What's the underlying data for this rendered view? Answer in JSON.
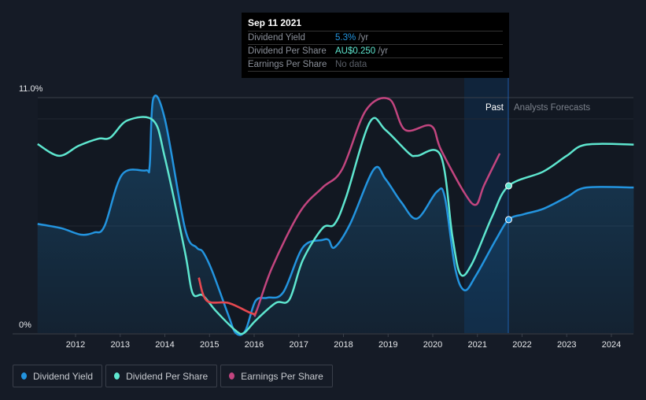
{
  "tooltip": {
    "date": "Sep 11 2021",
    "rows": [
      {
        "label": "Dividend Yield",
        "value": "5.3%",
        "unit": "/yr",
        "color": "#2394df"
      },
      {
        "label": "Dividend Per Share",
        "value": "AU$0.250",
        "unit": "/yr",
        "color": "#5ee6cf"
      },
      {
        "label": "Earnings Per Share",
        "value": "No data",
        "unit": "",
        "color": "#6b7079"
      }
    ]
  },
  "labels": {
    "past": "Past",
    "forecast": "Analysts Forecasts"
  },
  "legend": [
    {
      "label": "Dividend Yield",
      "color": "#2394df"
    },
    {
      "label": "Dividend Per Share",
      "color": "#5ee6cf"
    },
    {
      "label": "Earnings Per Share",
      "color": "#c2457f"
    }
  ],
  "chart_data": {
    "type": "line",
    "y_ticks": [
      "11.0%",
      "0%"
    ],
    "ylim": [
      0,
      11
    ],
    "x_ticks": [
      "2012",
      "2013",
      "2014",
      "2015",
      "2016",
      "2017",
      "2018",
      "2019",
      "2020",
      "2021",
      "2022",
      "2023",
      "2024"
    ],
    "forecast_start": 2021.7,
    "series": [
      {
        "name": "Dividend Yield",
        "unit": "%",
        "color": "#2394df",
        "points": [
          [
            2011.15,
            5.1
          ],
          [
            2011.68,
            4.9
          ],
          [
            2012.12,
            4.6
          ],
          [
            2012.42,
            4.7
          ],
          [
            2012.65,
            5.0
          ],
          [
            2013.04,
            7.4
          ],
          [
            2013.57,
            7.6
          ],
          [
            2013.66,
            7.8
          ],
          [
            2013.74,
            10.95
          ],
          [
            2014.0,
            10.0
          ],
          [
            2014.45,
            4.9
          ],
          [
            2014.71,
            4.0
          ],
          [
            2014.85,
            3.8
          ],
          [
            2015.06,
            2.9
          ],
          [
            2015.42,
            0.85
          ],
          [
            2015.59,
            0
          ],
          [
            2015.8,
            0.1
          ],
          [
            2016.03,
            1.5
          ],
          [
            2016.29,
            1.65
          ],
          [
            2016.65,
            1.9
          ],
          [
            2017.09,
            4.0
          ],
          [
            2017.53,
            4.35
          ],
          [
            2017.67,
            4.35
          ],
          [
            2017.8,
            4.0
          ],
          [
            2018.15,
            5.1
          ],
          [
            2018.68,
            7.65
          ],
          [
            2018.94,
            7.2
          ],
          [
            2019.3,
            6.1
          ],
          [
            2019.65,
            5.35
          ],
          [
            2020.09,
            6.6
          ],
          [
            2020.27,
            6.35
          ],
          [
            2020.5,
            3.05
          ],
          [
            2020.71,
            2.0
          ],
          [
            2020.97,
            2.7
          ],
          [
            2021.41,
            4.35
          ],
          [
            2021.7,
            5.3
          ],
          [
            2022.03,
            5.55
          ],
          [
            2022.47,
            5.8
          ],
          [
            2023.0,
            6.35
          ],
          [
            2023.44,
            6.8
          ],
          [
            2024.5,
            6.8
          ]
        ]
      },
      {
        "name": "Dividend Per Share",
        "unit": "AU$",
        "color": "#5ee6cf",
        "points": [
          [
            2011.15,
            0.321
          ],
          [
            2011.63,
            0.301
          ],
          [
            2012.07,
            0.318
          ],
          [
            2012.51,
            0.33
          ],
          [
            2012.78,
            0.332
          ],
          [
            2013.16,
            0.361
          ],
          [
            2013.74,
            0.361
          ],
          [
            2014.0,
            0.298
          ],
          [
            2014.45,
            0.138
          ],
          [
            2014.62,
            0.068
          ],
          [
            2014.85,
            0.064
          ],
          [
            2015.15,
            0.037
          ],
          [
            2015.59,
            0.004
          ],
          [
            2015.77,
            0
          ],
          [
            2016.03,
            0.021
          ],
          [
            2016.48,
            0.051
          ],
          [
            2016.79,
            0.057
          ],
          [
            2017.09,
            0.124
          ],
          [
            2017.53,
            0.178
          ],
          [
            2017.8,
            0.185
          ],
          [
            2018.06,
            0.231
          ],
          [
            2018.59,
            0.358
          ],
          [
            2018.94,
            0.345
          ],
          [
            2019.47,
            0.305
          ],
          [
            2019.65,
            0.301
          ],
          [
            2020.18,
            0.301
          ],
          [
            2020.44,
            0.164
          ],
          [
            2020.62,
            0.1
          ],
          [
            2020.88,
            0.118
          ],
          [
            2021.33,
            0.198
          ],
          [
            2021.7,
            0.25
          ],
          [
            2022.47,
            0.274
          ],
          [
            2023.0,
            0.301
          ],
          [
            2023.44,
            0.32
          ],
          [
            2024.5,
            0.32
          ]
        ]
      },
      {
        "name": "Earnings Per Share",
        "unit": "AU$",
        "color": "#c2457f",
        "negative_color": "#e5484d",
        "points": [
          [
            2014.76,
            0.094
          ],
          [
            2014.94,
            0.055
          ],
          [
            2015.43,
            0.051
          ],
          [
            2015.96,
            0.033
          ],
          [
            2016.05,
            0.037
          ],
          [
            2016.4,
            0.111
          ],
          [
            2017.02,
            0.205
          ],
          [
            2017.53,
            0.247
          ],
          [
            2017.97,
            0.278
          ],
          [
            2018.5,
            0.378
          ],
          [
            2019.03,
            0.397
          ],
          [
            2019.38,
            0.345
          ],
          [
            2019.96,
            0.352
          ],
          [
            2020.18,
            0.312
          ],
          [
            2020.71,
            0.238
          ],
          [
            2020.97,
            0.218
          ],
          [
            2021.15,
            0.251
          ],
          [
            2021.5,
            0.305
          ]
        ]
      }
    ]
  }
}
